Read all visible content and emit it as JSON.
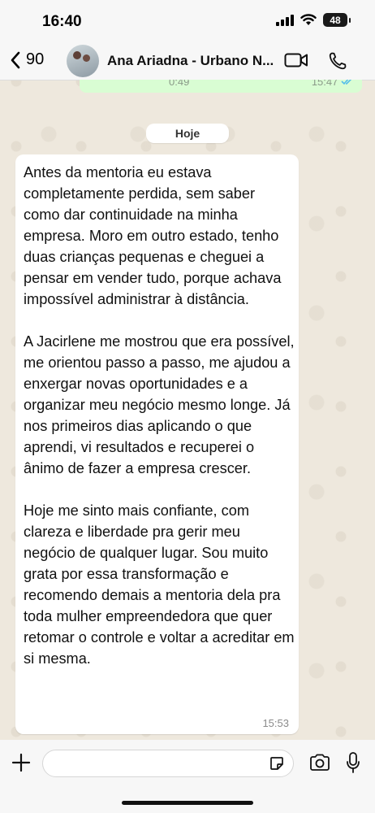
{
  "status_bar": {
    "time": "16:40",
    "battery": "48"
  },
  "header": {
    "back_count": "90",
    "contact_name": "Ana Ariadna - Urbano N..."
  },
  "previous_message": {
    "duration": "0:49",
    "time": "15:47"
  },
  "date_separator": "Hoje",
  "message": {
    "text": "Antes da mentoria eu estava completamente perdida, sem saber como dar continuidade na minha empresa. Moro em outro estado, tenho duas crianças pequenas e cheguei a pensar em vender tudo, porque achava impossível administrar à distância.\n\nA Jacirlene me mostrou que era possível, me orientou passo a passo, me ajudou a enxergar novas oportunidades e a organizar meu negócio mesmo longe. Já nos primeiros dias aplicando o que aprendi, vi resultados e recuperei o ânimo de fazer a empresa crescer.\n\nHoje me sinto mais confiante, com clareza e liberdade pra gerir meu negócio de qualquer lugar. Sou muito grata por essa transformação e recomendo demais a mentoria dela pra toda mulher empreendedora que quer retomar o controle e voltar a acreditar em si mesma.",
    "time": "15:53"
  },
  "colors": {
    "outgoing_bubble": "#d9fdd3",
    "incoming_bubble": "#ffffff",
    "read_ticks": "#53bdeb"
  },
  "icons": [
    "chevron-left-icon",
    "video-call-icon",
    "phone-icon",
    "plus-icon",
    "sticker-icon",
    "camera-icon",
    "microphone-icon"
  ]
}
